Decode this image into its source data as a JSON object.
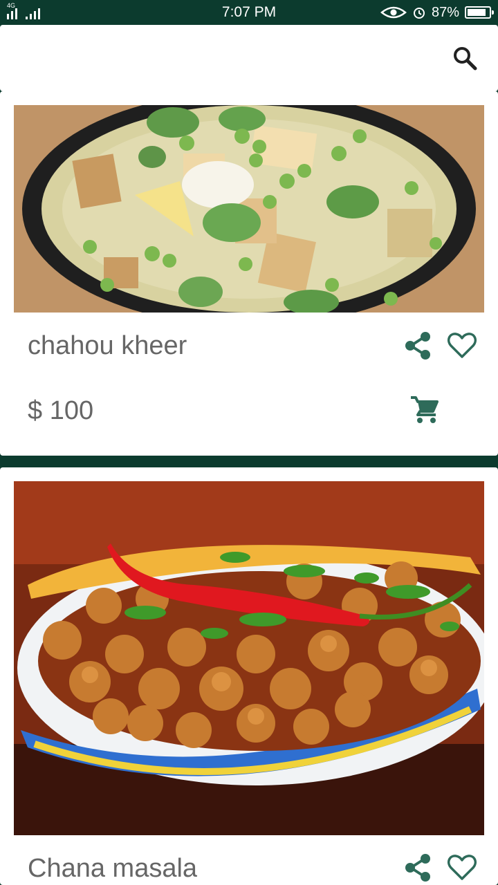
{
  "status_bar": {
    "network": "4G",
    "time": "7:07 PM",
    "battery": "87%",
    "battery_level": 0.87
  },
  "search": {
    "value": "",
    "placeholder": "",
    "icon": "search-icon"
  },
  "items": [
    {
      "name": "chahou kheer",
      "price": "$ 100",
      "image": "paneer-peas-curry-photo",
      "icons": [
        "share-icon",
        "heart-outline-icon",
        "cart-icon"
      ]
    },
    {
      "name": "Chana masala",
      "image": "chana-masala-photo",
      "icons": [
        "share-icon",
        "heart-outline-icon"
      ]
    }
  ],
  "colors": {
    "primary_dark": "#0c3b2e",
    "icon_accent": "#2e6b5a",
    "text_gray": "#666666"
  }
}
